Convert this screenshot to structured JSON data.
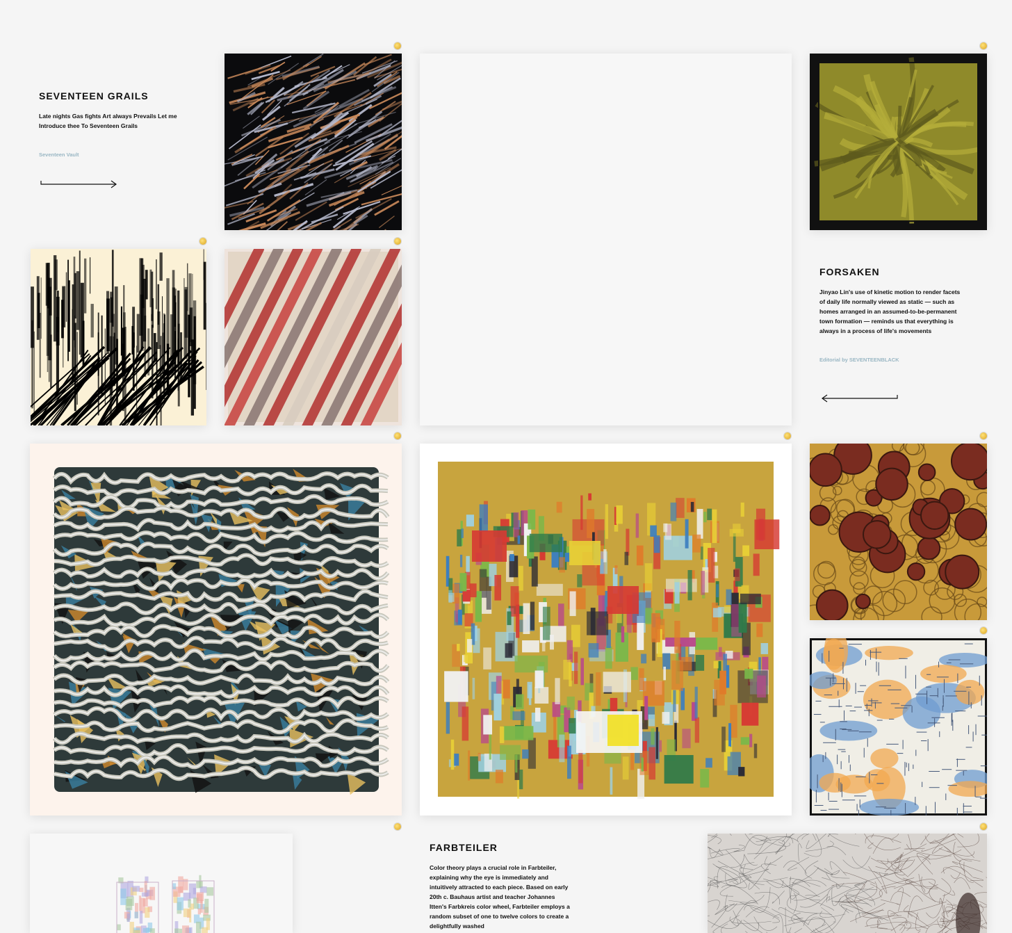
{
  "collections": [
    {
      "title": "SEVENTEEN GRAILS",
      "description": "Late nights Gas fights Art always Prevails Let me Introduce thee To Seventeen Grails",
      "credit": "Seventeen Vault",
      "arrow_direction": "right"
    },
    {
      "title": "FORSAKEN",
      "description": "Jinyao Lin's use of kinetic motion to render facets of daily life normally viewed as static — such as homes arranged in an assumed-to-be-permanent town formation — reminds us that everything is always in a process of life's movements",
      "credit": "Editorial by SEVENTEENBLACK",
      "arrow_direction": "left"
    },
    {
      "title": "FARBTEILER",
      "description": "Color theory plays a crucial role in Farbteiler, explaining why the eye is immediately and intuitively attracted to each piece. Based on early 20th c. Bauhaus artist and teacher Johannes Itten's Farbkreis color wheel, Farbteiler employs a random subset of one to twelve colors to create a delightfully washed"
    }
  ],
  "artworks": [
    {
      "name": "dark-feather-streaks",
      "palette": [
        "#0b0b0d",
        "#b6b9cc",
        "#c9895a"
      ]
    },
    {
      "name": "olive-leaf-pattern",
      "palette": [
        "#111111",
        "#8f8a2a",
        "#b5ae3b"
      ]
    },
    {
      "name": "black-barcode-city",
      "palette": [
        "#fbf1d6",
        "#000000"
      ]
    },
    {
      "name": "red-diagonal-tubes",
      "palette": [
        "#e3d6c6",
        "#b53a38",
        "#8e7b77"
      ]
    },
    {
      "name": "placeholder-blank",
      "palette": [
        "#f7f7f7"
      ]
    },
    {
      "name": "wavy-maze-pattern",
      "palette": [
        "#fdf3ec",
        "#c9c8bd",
        "#3a7fa0",
        "#d08a2d"
      ]
    },
    {
      "name": "farbteiler-color-blocks",
      "palette": [
        "#c8a43e",
        "#d63a33",
        "#2a2a35",
        "#3b7ec0",
        "#e8d036"
      ]
    },
    {
      "name": "brown-circles-gold",
      "palette": [
        "#7a2c20",
        "#c89a3a"
      ]
    },
    {
      "name": "blue-orange-maze",
      "palette": [
        "#f0eee6",
        "#6f9cd0",
        "#f2a850"
      ]
    },
    {
      "name": "pastel-stacked-blocks",
      "palette": [
        "#f7f7f7",
        "#a8c8a0",
        "#f0a8a0",
        "#b0a8e0"
      ]
    },
    {
      "name": "grey-scribble-lines",
      "palette": [
        "#d8d4d0",
        "#5a4640"
      ]
    }
  ]
}
